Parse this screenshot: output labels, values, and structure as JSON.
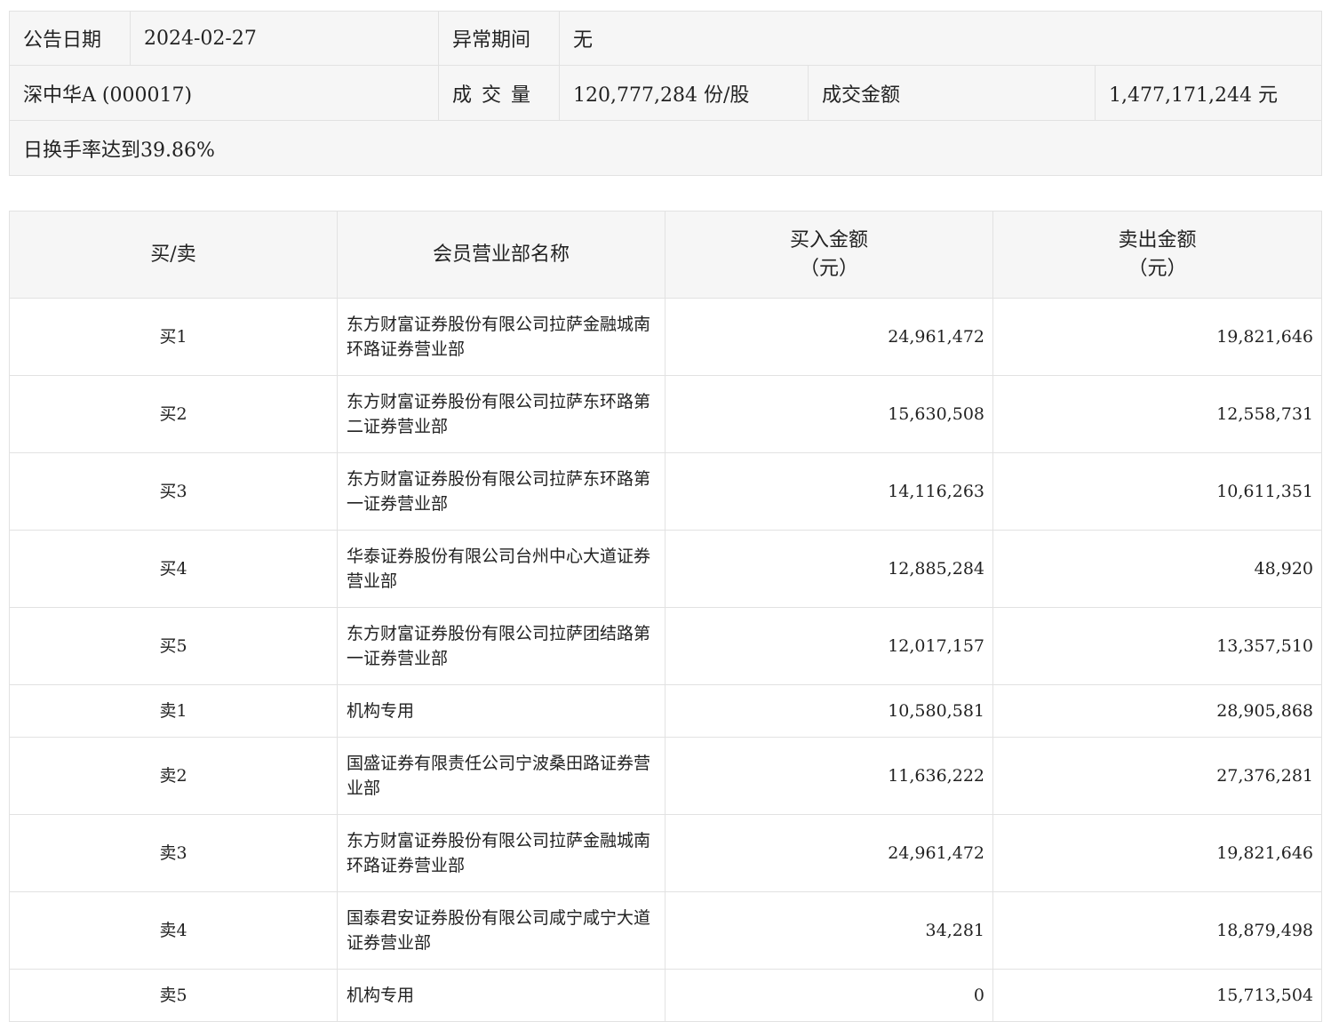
{
  "info": {
    "date_label": "公告日期",
    "date_value": "2024-02-27",
    "period_label": "异常期间",
    "period_value": "无",
    "stock_name": "深中华A (000017)",
    "volume_label": "成交量",
    "volume_value": "120,777,284 份/股",
    "amount_label": "成交金额",
    "amount_value": "1,477,171,244 元",
    "note": "日换手率达到39.86%"
  },
  "table": {
    "headers": {
      "side": "买/卖",
      "name": "会员营业部名称",
      "buy_line1": "买入金额",
      "buy_line2": "（元）",
      "sell_line1": "卖出金额",
      "sell_line2": "（元）"
    },
    "rows": [
      {
        "side": "买1",
        "name": "东方财富证券股份有限公司拉萨金融城南环路证券营业部",
        "buy": "24,961,472",
        "sell": "19,821,646"
      },
      {
        "side": "买2",
        "name": "东方财富证券股份有限公司拉萨东环路第二证券营业部",
        "buy": "15,630,508",
        "sell": "12,558,731"
      },
      {
        "side": "买3",
        "name": "东方财富证券股份有限公司拉萨东环路第一证券营业部",
        "buy": "14,116,263",
        "sell": "10,611,351"
      },
      {
        "side": "买4",
        "name": "华泰证券股份有限公司台州中心大道证券营业部",
        "buy": "12,885,284",
        "sell": "48,920"
      },
      {
        "side": "买5",
        "name": "东方财富证券股份有限公司拉萨团结路第一证券营业部",
        "buy": "12,017,157",
        "sell": "13,357,510"
      },
      {
        "side": "卖1",
        "name": "机构专用",
        "buy": "10,580,581",
        "sell": "28,905,868"
      },
      {
        "side": "卖2",
        "name": "国盛证券有限责任公司宁波桑田路证券营业部",
        "buy": "11,636,222",
        "sell": "27,376,281"
      },
      {
        "side": "卖3",
        "name": "东方财富证券股份有限公司拉萨金融城南环路证券营业部",
        "buy": "24,961,472",
        "sell": "19,821,646"
      },
      {
        "side": "卖4",
        "name": "国泰君安证券股份有限公司咸宁咸宁大道证券营业部",
        "buy": "34,281",
        "sell": "18,879,498"
      },
      {
        "side": "卖5",
        "name": "机构专用",
        "buy": "0",
        "sell": "15,713,504"
      }
    ]
  }
}
